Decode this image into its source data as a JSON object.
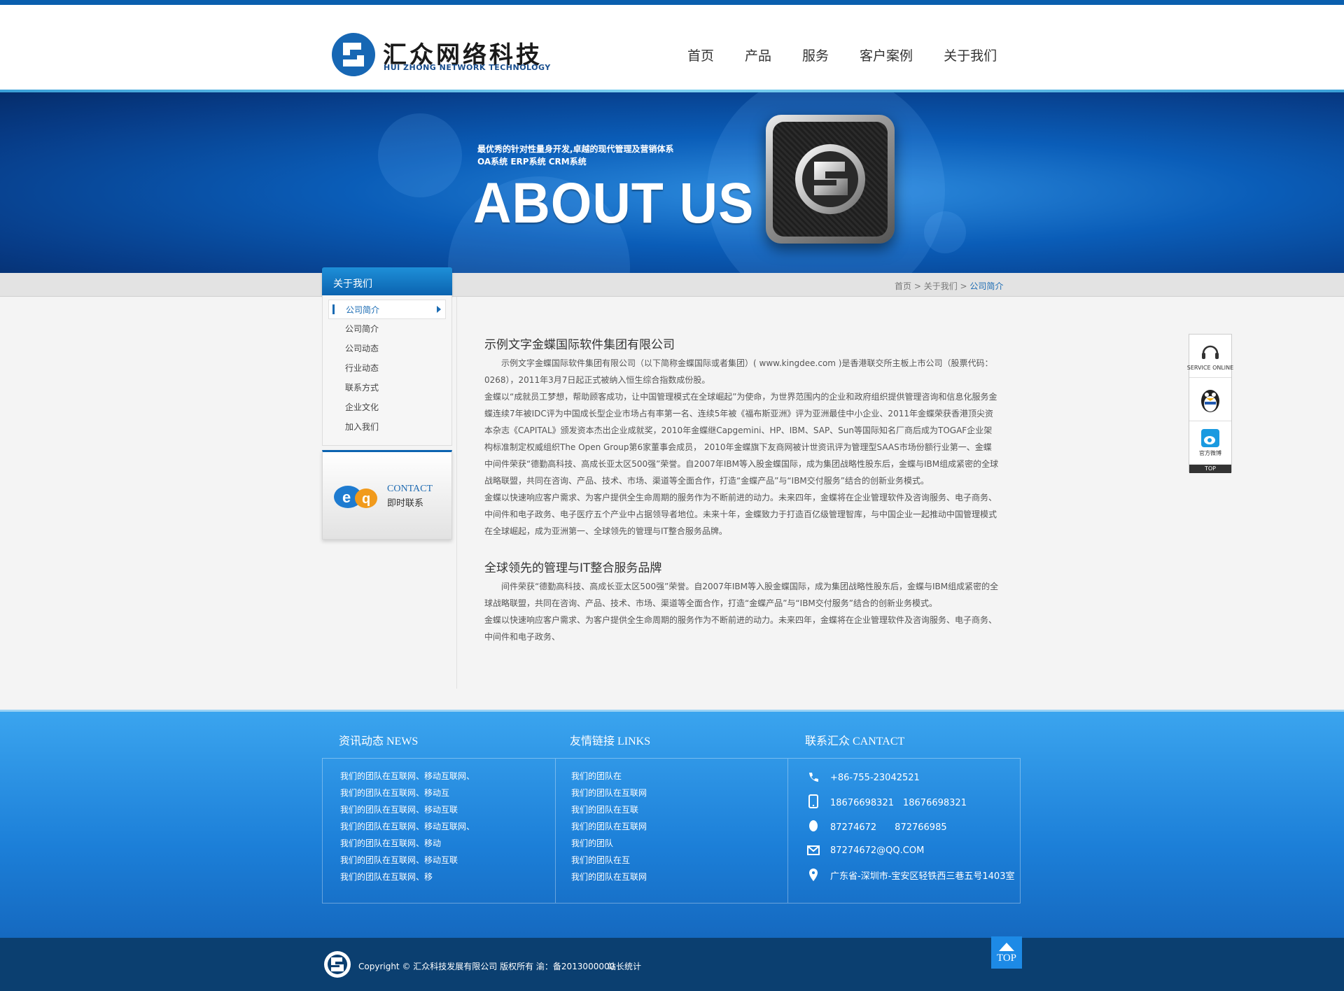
{
  "brand": {
    "name": "汇众网络科技",
    "sub": "HUI ZHONG NETWORK TECHNOLOGY",
    "color": "#0a5fae"
  },
  "nav": [
    "首页",
    "产品",
    "服务",
    "客户案例",
    "关于我们"
  ],
  "banner": {
    "slogan1": "最优秀的针对性量身开发,卓越的现代管理及营销体系",
    "slogan2": "OA系统 ERP系统 CRM系统",
    "title": "ABOUT US"
  },
  "breadcrumb": {
    "home": "首页",
    "sep": " > ",
    "parent": "关于我们",
    "current": "公司简介"
  },
  "sidebar": {
    "title": "关于我们",
    "items": [
      "公司简介",
      "公司简介",
      "公司动态",
      "行业动态",
      "联系方式",
      "企业文化",
      "加入我们"
    ],
    "contact_en": "CONTACT",
    "contact_cn": "即时联系"
  },
  "main": {
    "heading1": "示例文字金蝶国际软件集团有限公司",
    "para1": "　　示例文字金蝶国际软件集团有限公司（以下简称金蝶国际或者集团）( www.kingdee.com )是香港联交所主板上市公司（股票代码：0268），2011年3月7日起正式被纳入恒生综合指数成份股。",
    "para2": "金蝶以“成就员工梦想，帮助顾客成功，让中国管理模式在全球崛起”为使命，为世界范围内的企业和政府组织提供管理咨询和信息化服务金蝶连续7年被IDC评为中国成长型企业市场占有率第一名、连续5年被《福布斯亚洲》评为亚洲最佳中小企业、2011年金蝶荣获香港顶尖资本杂志《CAPITAL》颁发资本杰出企业成就奖，2010年金蝶继Capgemini、HP、IBM、SAP、Sun等国际知名厂商后成为TOGAF企业架构标准制定权威组织The Open Group第6家董事会成员， 2010年金蝶旗下友商网被计世资讯评为管理型SAAS市场份额行业第一、金蝶中间件荣获“德勤高科技、高成长亚太区500强”荣誉。自2007年IBM等入股金蝶国际，成为集团战略性股东后，金蝶与IBM组成紧密的全球战略联盟，共同在咨询、产品、技术、市场、渠道等全面合作，打造“金蝶产品”与“IBM交付服务”结合的创新业务模式。",
    "para3": "金蝶以快速响应客户需求、为客户提供全生命周期的服务作为不断前进的动力。未来四年，金蝶将在企业管理软件及咨询服务、电子商务、中间件和电子政务、电子医疗五个产业中占据领导者地位。未来十年，金蝶致力于打造百亿级管理智库，与中国企业一起推动中国管理模式在全球崛起，成为亚洲第一、全球领先的管理与IT整合服务品牌。",
    "heading2": "全球领先的管理与IT整合服务品牌",
    "para4": "　　间件荣获“德勤高科技、高成长亚太区500强”荣誉。自2007年IBM等入股金蝶国际，成为集团战略性股东后，金蝶与IBM组成紧密的全球战略联盟，共同在咨询、产品、技术、市场、渠道等全面合作，打造“金蝶产品”与“IBM交付服务”结合的创新业务模式。",
    "para5": "金蝶以快速响应客户需求、为客户提供全生命周期的服务作为不断前进的动力。未来四年，金蝶将在企业管理软件及咨询服务、电子商务、中间件和电子政务、"
  },
  "float_panel": {
    "service": "SERVICE ONLINE",
    "weibo": "官方微博",
    "top": "TOP"
  },
  "footer": {
    "news_title": "资讯动态 NEWS",
    "links_title": "友情链接 LINKS",
    "contact_title": "联系汇众 CANTACT",
    "news": [
      "我们的团队在互联网、移动互联网、",
      "我们的团队在互联网、移动互",
      "我们的团队在互联网、移动互联",
      "我们的团队在互联网、移动互联网、",
      "我们的团队在互联网、移动",
      "我们的团队在互联网、移动互联",
      "我们的团队在互联网、移"
    ],
    "links": [
      "我们的团队在",
      "我们的团队在互联网",
      "我们的团队在互联",
      "我们的团队在互联网",
      "我们的团队",
      "我们的团队在互",
      "我们的团队在互联网"
    ],
    "contact": {
      "phone": "+86-755-23042521",
      "mobile": "18676698321　18676698321",
      "qq": "87274672　　87276698​5",
      "email": "87274672@QQ.COM",
      "address": "广东省-深圳市-宝安区轻铁西三巷五号1403室"
    }
  },
  "bottom": {
    "copyright": "Copyright © 汇众科技发展有限公司 版权所有  渝：备2013000000",
    "stats": "站长统计",
    "top": "TOP"
  }
}
